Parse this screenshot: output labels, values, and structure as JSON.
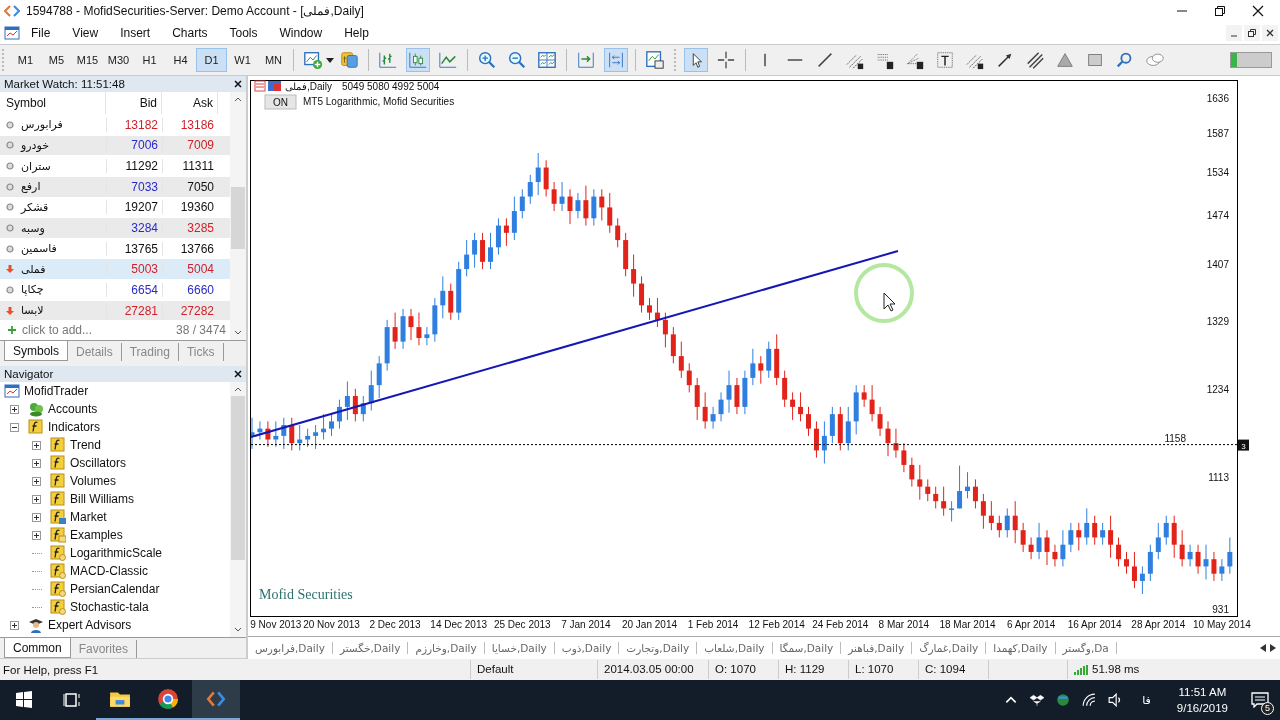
{
  "window": {
    "title": "1594788 - MofidSecurities-Server: Demo Account - [فملی,Daily]"
  },
  "menu": [
    "File",
    "View",
    "Insert",
    "Charts",
    "Tools",
    "Window",
    "Help"
  ],
  "timeframes": [
    {
      "label": "M1",
      "selected": false
    },
    {
      "label": "M5",
      "selected": false
    },
    {
      "label": "M15",
      "selected": false
    },
    {
      "label": "M30",
      "selected": false
    },
    {
      "label": "H1",
      "selected": false
    },
    {
      "label": "H4",
      "selected": false
    },
    {
      "label": "D1",
      "selected": true
    },
    {
      "label": "W1",
      "selected": false
    },
    {
      "label": "MN",
      "selected": false
    }
  ],
  "market_watch": {
    "title": "Market Watch: 11:51:48",
    "columns": [
      "Symbol",
      "Bid",
      "Ask"
    ],
    "rows": [
      {
        "symbol": "فرابورس",
        "bid": {
          "text": "13182",
          "color": "#d0202a"
        },
        "ask": {
          "text": "13186",
          "color": "#d0202a"
        },
        "kind": "dot",
        "selected": false
      },
      {
        "symbol": "خودرو",
        "bid": {
          "text": "7006",
          "color": "#2a2ac8"
        },
        "ask": {
          "text": "7009",
          "color": "#d0202a"
        },
        "kind": "dot",
        "selected": false
      },
      {
        "symbol": "ستران",
        "bid": {
          "text": "11292",
          "color": "#111111"
        },
        "ask": {
          "text": "11311",
          "color": "#111111"
        },
        "kind": "dot",
        "selected": false
      },
      {
        "symbol": "ارفع",
        "bid": {
          "text": "7033",
          "color": "#2a2ac8"
        },
        "ask": {
          "text": "7050",
          "color": "#111111"
        },
        "kind": "dot",
        "selected": false
      },
      {
        "symbol": "قشکر",
        "bid": {
          "text": "19207",
          "color": "#111111"
        },
        "ask": {
          "text": "19360",
          "color": "#111111"
        },
        "kind": "dot",
        "selected": false
      },
      {
        "symbol": "وسبه",
        "bid": {
          "text": "3284",
          "color": "#2a2ac8"
        },
        "ask": {
          "text": "3285",
          "color": "#d0202a"
        },
        "kind": "dot",
        "selected": false
      },
      {
        "symbol": "فاسمین",
        "bid": {
          "text": "13765",
          "color": "#111111"
        },
        "ask": {
          "text": "13766",
          "color": "#111111"
        },
        "kind": "dot",
        "selected": false
      },
      {
        "symbol": "فملی",
        "bid": {
          "text": "5003",
          "color": "#d0202a"
        },
        "ask": {
          "text": "5004",
          "color": "#d0202a"
        },
        "kind": "down",
        "selected": true
      },
      {
        "symbol": "چکاپا",
        "bid": {
          "text": "6654",
          "color": "#2a2ac8"
        },
        "ask": {
          "text": "6660",
          "color": "#2a2ac8"
        },
        "kind": "dot",
        "selected": false
      },
      {
        "symbol": "لابسا",
        "bid": {
          "text": "27281",
          "color": "#d0202a"
        },
        "ask": {
          "text": "27282",
          "color": "#d0202a"
        },
        "kind": "down",
        "selected": false
      }
    ],
    "add_label": "click to add...",
    "count": "38 / 3474",
    "tabs": [
      {
        "label": "Symbols",
        "selected": true
      },
      {
        "label": "Details",
        "selected": false
      },
      {
        "label": "Trading",
        "selected": false
      },
      {
        "label": "Ticks",
        "selected": false
      }
    ]
  },
  "navigator": {
    "title": "Navigator",
    "tree": [
      {
        "label": "MofidTrader",
        "kind": "root",
        "children": [
          {
            "label": "Accounts",
            "kind": "accounts",
            "expanded": false
          },
          {
            "label": "Indicators",
            "kind": "folder",
            "expanded": true,
            "children": [
              {
                "label": "Trend",
                "kind": "folder",
                "expanded": false
              },
              {
                "label": "Oscillators",
                "kind": "folder",
                "expanded": false
              },
              {
                "label": "Volumes",
                "kind": "folder",
                "expanded": false
              },
              {
                "label": "Bill Williams",
                "kind": "folder",
                "expanded": false
              },
              {
                "label": "Market",
                "kind": "market",
                "expanded": false
              },
              {
                "label": "Examples",
                "kind": "examples",
                "expanded": false
              },
              {
                "label": "LogarithmicScale",
                "kind": "indicator"
              },
              {
                "label": "MACD-Classic",
                "kind": "indicator"
              },
              {
                "label": "PersianCalendar",
                "kind": "indicator"
              },
              {
                "label": "Stochastic-tala",
                "kind": "indicator"
              }
            ]
          },
          {
            "label": "Expert Advisors",
            "kind": "experts",
            "expanded": false
          }
        ]
      }
    ],
    "tabs": [
      {
        "label": "Common",
        "selected": true
      },
      {
        "label": "Favorites",
        "selected": false
      }
    ]
  },
  "chart": {
    "header": "فملی,Daily",
    "ohlc": "5049 5080 4992 5004",
    "on_button": "ON",
    "indicator": "MT5 Logarithmic, Mofid Securities",
    "footer": "Mofid Securities",
    "price_line_label": "1158",
    "price_line_badge": "3",
    "chart_data": {
      "type": "candlestick",
      "categories": [
        null,
        null,
        null,
        "9 Nov 2013",
        null,
        null,
        null,
        null,
        null,
        null,
        "20 Nov 2013",
        null,
        null,
        null,
        null,
        null,
        null,
        null,
        "2 Dec 2013",
        null,
        null,
        null,
        null,
        null,
        null,
        null,
        "14 Dec 2013",
        null,
        null,
        null,
        null,
        null,
        null,
        null,
        "25 Dec 2013",
        null,
        null,
        null,
        null,
        null,
        null,
        null,
        "7 Jan 2014",
        null,
        null,
        null,
        null,
        null,
        null,
        null,
        "20 Jan 2014",
        null,
        null,
        null,
        null,
        null,
        null,
        null,
        "1 Feb 2014",
        null,
        null,
        null,
        null,
        null,
        null,
        null,
        "12 Feb 2014",
        null,
        null,
        null,
        null,
        null,
        null,
        null,
        "24 Feb 2014",
        null,
        null,
        null,
        null,
        null,
        null,
        null,
        "8 Mar 2014",
        null,
        null,
        null,
        null,
        null,
        null,
        null,
        "18 Mar 2014",
        null,
        null,
        null,
        null,
        null,
        null,
        null,
        "6 Apr 2014",
        null,
        null,
        null,
        null,
        null,
        null,
        null,
        "16 Apr 2014",
        null,
        null,
        null,
        null,
        null,
        null,
        null,
        "28 Apr 2014",
        null,
        null,
        null,
        null,
        null,
        null,
        null,
        "10 May 2014",
        null
      ],
      "ohlc": [
        [
          1170,
          1195,
          1152,
          1175
        ],
        [
          1175,
          1190,
          1165,
          1180
        ],
        [
          1180,
          1190,
          1155,
          1165
        ],
        [
          1165,
          1190,
          1155,
          1170
        ],
        [
          1170,
          1195,
          1152,
          1185
        ],
        [
          1185,
          1195,
          1150,
          1160
        ],
        [
          1160,
          1185,
          1150,
          1165
        ],
        [
          1165,
          1180,
          1155,
          1170
        ],
        [
          1170,
          1185,
          1152,
          1175
        ],
        [
          1175,
          1200,
          1165,
          1180
        ],
        [
          1180,
          1200,
          1170,
          1190
        ],
        [
          1190,
          1220,
          1180,
          1210
        ],
        [
          1210,
          1245,
          1192,
          1225
        ],
        [
          1225,
          1235,
          1190,
          1200
        ],
        [
          1200,
          1225,
          1190,
          1215
        ],
        [
          1215,
          1260,
          1205,
          1240
        ],
        [
          1240,
          1280,
          1222,
          1270
        ],
        [
          1270,
          1330,
          1260,
          1320
        ],
        [
          1320,
          1340,
          1290,
          1300
        ],
        [
          1300,
          1345,
          1290,
          1335
        ],
        [
          1335,
          1345,
          1302,
          1320
        ],
        [
          1320,
          1340,
          1295,
          1305
        ],
        [
          1305,
          1320,
          1295,
          1310
        ],
        [
          1310,
          1360,
          1300,
          1350
        ],
        [
          1350,
          1390,
          1332,
          1370
        ],
        [
          1370,
          1380,
          1330,
          1340
        ],
        [
          1340,
          1410,
          1330,
          1400
        ],
        [
          1400,
          1440,
          1390,
          1420
        ],
        [
          1420,
          1450,
          1402,
          1440
        ],
        [
          1440,
          1450,
          1400,
          1410
        ],
        [
          1410,
          1450,
          1400,
          1430
        ],
        [
          1430,
          1470,
          1420,
          1460
        ],
        [
          1460,
          1470,
          1432,
          1450
        ],
        [
          1450,
          1500,
          1440,
          1480
        ],
        [
          1480,
          1510,
          1470,
          1500
        ],
        [
          1500,
          1530,
          1490,
          1520
        ],
        [
          1520,
          1560,
          1502,
          1540
        ],
        [
          1540,
          1550,
          1500,
          1510
        ],
        [
          1510,
          1520,
          1480,
          1490
        ],
        [
          1490,
          1520,
          1480,
          1500
        ],
        [
          1500,
          1510,
          1462,
          1480
        ],
        [
          1480,
          1505,
          1470,
          1495
        ],
        [
          1495,
          1515,
          1460,
          1470
        ],
        [
          1470,
          1510,
          1460,
          1500
        ],
        [
          1500,
          1510,
          1467,
          1485
        ],
        [
          1485,
          1505,
          1450,
          1460
        ],
        [
          1460,
          1470,
          1430,
          1440
        ],
        [
          1440,
          1450,
          1390,
          1400
        ],
        [
          1400,
          1420,
          1362,
          1380
        ],
        [
          1380,
          1390,
          1340,
          1350
        ],
        [
          1350,
          1360,
          1330,
          1340
        ],
        [
          1340,
          1360,
          1320,
          1330
        ],
        [
          1330,
          1340,
          1292,
          1310
        ],
        [
          1310,
          1320,
          1270,
          1280
        ],
        [
          1280,
          1300,
          1250,
          1260
        ],
        [
          1260,
          1270,
          1230,
          1240
        ],
        [
          1240,
          1250,
          1192,
          1210
        ],
        [
          1210,
          1230,
          1180,
          1190
        ],
        [
          1190,
          1210,
          1180,
          1200
        ],
        [
          1200,
          1230,
          1190,
          1220
        ],
        [
          1220,
          1260,
          1202,
          1240
        ],
        [
          1240,
          1250,
          1200,
          1210
        ],
        [
          1210,
          1260,
          1200,
          1250
        ],
        [
          1250,
          1290,
          1240,
          1270
        ],
        [
          1270,
          1280,
          1242,
          1260
        ],
        [
          1260,
          1300,
          1250,
          1290
        ],
        [
          1290,
          1310,
          1240,
          1250
        ],
        [
          1250,
          1260,
          1210,
          1220
        ],
        [
          1220,
          1230,
          1192,
          1210
        ],
        [
          1210,
          1230,
          1190,
          1200
        ],
        [
          1200,
          1210,
          1170,
          1180
        ],
        [
          1180,
          1190,
          1140,
          1150
        ],
        [
          1150,
          1190,
          1132,
          1170
        ],
        [
          1170,
          1210,
          1160,
          1200
        ],
        [
          1200,
          1210,
          1150,
          1160
        ],
        [
          1160,
          1210,
          1150,
          1190
        ],
        [
          1190,
          1240,
          1172,
          1230
        ],
        [
          1230,
          1240,
          1210,
          1220
        ],
        [
          1220,
          1240,
          1190,
          1200
        ],
        [
          1200,
          1210,
          1170,
          1180
        ],
        [
          1180,
          1190,
          1142,
          1160
        ],
        [
          1160,
          1180,
          1140,
          1150
        ],
        [
          1150,
          1160,
          1120,
          1130
        ],
        [
          1130,
          1140,
          1100,
          1110
        ],
        [
          1110,
          1130,
          1082,
          1100
        ],
        [
          1100,
          1110,
          1080,
          1090
        ],
        [
          1090,
          1100,
          1070,
          1080
        ],
        [
          1080,
          1100,
          1060,
          1070
        ],
        [
          1070,
          1080,
          1052,
          1070
        ],
        [
          1070,
          1129,
          1070,
          1094
        ],
        [
          1094,
          1120,
          1084,
          1100
        ],
        [
          1100,
          1110,
          1070,
          1080
        ],
        [
          1080,
          1090,
          1042,
          1060
        ],
        [
          1060,
          1080,
          1040,
          1050
        ],
        [
          1050,
          1060,
          1030,
          1040
        ],
        [
          1040,
          1070,
          1030,
          1060
        ],
        [
          1060,
          1080,
          1022,
          1040
        ],
        [
          1040,
          1050,
          1010,
          1020
        ],
        [
          1020,
          1030,
          1000,
          1010
        ],
        [
          1010,
          1050,
          1000,
          1030
        ],
        [
          1030,
          1040,
          992,
          1010
        ],
        [
          1010,
          1020,
          990,
          1000
        ],
        [
          1000,
          1040,
          990,
          1020
        ],
        [
          1020,
          1050,
          1010,
          1040
        ],
        [
          1040,
          1050,
          1012,
          1030
        ],
        [
          1030,
          1070,
          1020,
          1050
        ],
        [
          1050,
          1060,
          1020,
          1030
        ],
        [
          1030,
          1050,
          1020,
          1040
        ],
        [
          1040,
          1060,
          1002,
          1020
        ],
        [
          1020,
          1030,
          990,
          1000
        ],
        [
          1000,
          1010,
          980,
          990
        ],
        [
          990,
          1010,
          960,
          970
        ],
        [
          970,
          990,
          952,
          980
        ],
        [
          980,
          1020,
          970,
          1010
        ],
        [
          1010,
          1050,
          1000,
          1030
        ],
        [
          1030,
          1060,
          1020,
          1050
        ],
        [
          1050,
          1060,
          1002,
          1020
        ],
        [
          1020,
          1040,
          990,
          1000
        ],
        [
          1000,
          1020,
          990,
          1010
        ],
        [
          1010,
          1020,
          980,
          990
        ],
        [
          990,
          1020,
          972,
          1000
        ],
        [
          1000,
          1010,
          970,
          980
        ],
        [
          980,
          1000,
          970,
          990
        ],
        [
          990,
          1030,
          980,
          1010
        ]
      ],
      "ylim": [
        921,
        1660
      ],
      "yticks": [
        1636,
        1587,
        1534,
        1474,
        1407,
        1329,
        1234,
        1113,
        931
      ]
    }
  },
  "chart_tabs": [
    "فرابورس,Daily",
    "خگستر,Daily",
    "وخارزم,Daily",
    "خسایا,Daily",
    "ذوب,Daily",
    "وتجارت,Daily",
    "شلعاب,Daily",
    "سمگا,Daily",
    "فباهنر,Daily",
    "غمارگ,Daily",
    "کهمدا,Daily",
    "وگستر,Da"
  ],
  "status_bar": {
    "help": "For Help, press F1",
    "profile": "Default",
    "time": "2014.03.05 00:00",
    "open": "O: 1070",
    "high": "H: 1129",
    "low": "L: 1070",
    "close": "C: 1094",
    "ping": "51.98 ms"
  },
  "taskbar": {
    "language": "فا",
    "time": "11:51 AM",
    "date": "9/16/2019",
    "notifications": "5"
  }
}
